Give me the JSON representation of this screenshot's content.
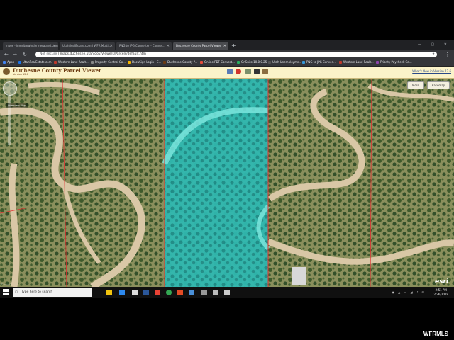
{
  "browser": {
    "tabs": [
      {
        "label": "Inbox - jgmslt@windermeraland.com",
        "active": false
      },
      {
        "label": "UtahRealEstate.com | WFR Multi...",
        "active": false
      },
      {
        "label": "PNG to JPG Converter - Conver...",
        "active": false
      },
      {
        "label": "Duchesne County Parcel Viewer",
        "active": true
      }
    ],
    "new_tab": "+",
    "url_security": "Not secure",
    "url": "maps.duchesne.utah.gov/Viewers/Parcels/default.htm",
    "bookmarks": [
      {
        "label": "Apps",
        "color": "#4285f4"
      },
      {
        "label": "UtahRealEstate.com",
        "color": "#1a73e8"
      },
      {
        "label": "Western Land Realt...",
        "color": "#c0392b"
      },
      {
        "label": "Property Control Co...",
        "color": "#888888"
      },
      {
        "label": "DocuSign Login - E...",
        "color": "#f4b400"
      },
      {
        "label": "Duchesne County P...",
        "color": "#6d3b12"
      },
      {
        "label": "Online PDF Convert...",
        "color": "#e74c3c"
      },
      {
        "label": "OnSuite 10.0.0.25",
        "color": "#27ae60"
      },
      {
        "label": "Utah Unemployme...",
        "color": "#555555"
      },
      {
        "label": "PNG to JPG Conver...",
        "color": "#3498db"
      },
      {
        "label": "Western Land Realt...",
        "color": "#c0392b"
      },
      {
        "label": "Priority Paycheck Ca...",
        "color": "#8e44ad"
      }
    ]
  },
  "app": {
    "title": "Duchesne County Parcel Viewer",
    "version": "Version 12.6",
    "whats_new": "What's New in Version 12.6",
    "buttons": {
      "more": "More",
      "basemap": "Basemap"
    },
    "overview_label": "Overview Map",
    "attribution": "esri"
  },
  "taskbar": {
    "search_placeholder": "Type here to search",
    "time": "2:51 PM",
    "date": "2/26/2019"
  },
  "watermark": "WFRMLS",
  "colors": {
    "highlight": "#3fd9cf",
    "road": "#d9c7a6",
    "terrain": "#6e7f4a",
    "parcel_line": "#e03030"
  }
}
